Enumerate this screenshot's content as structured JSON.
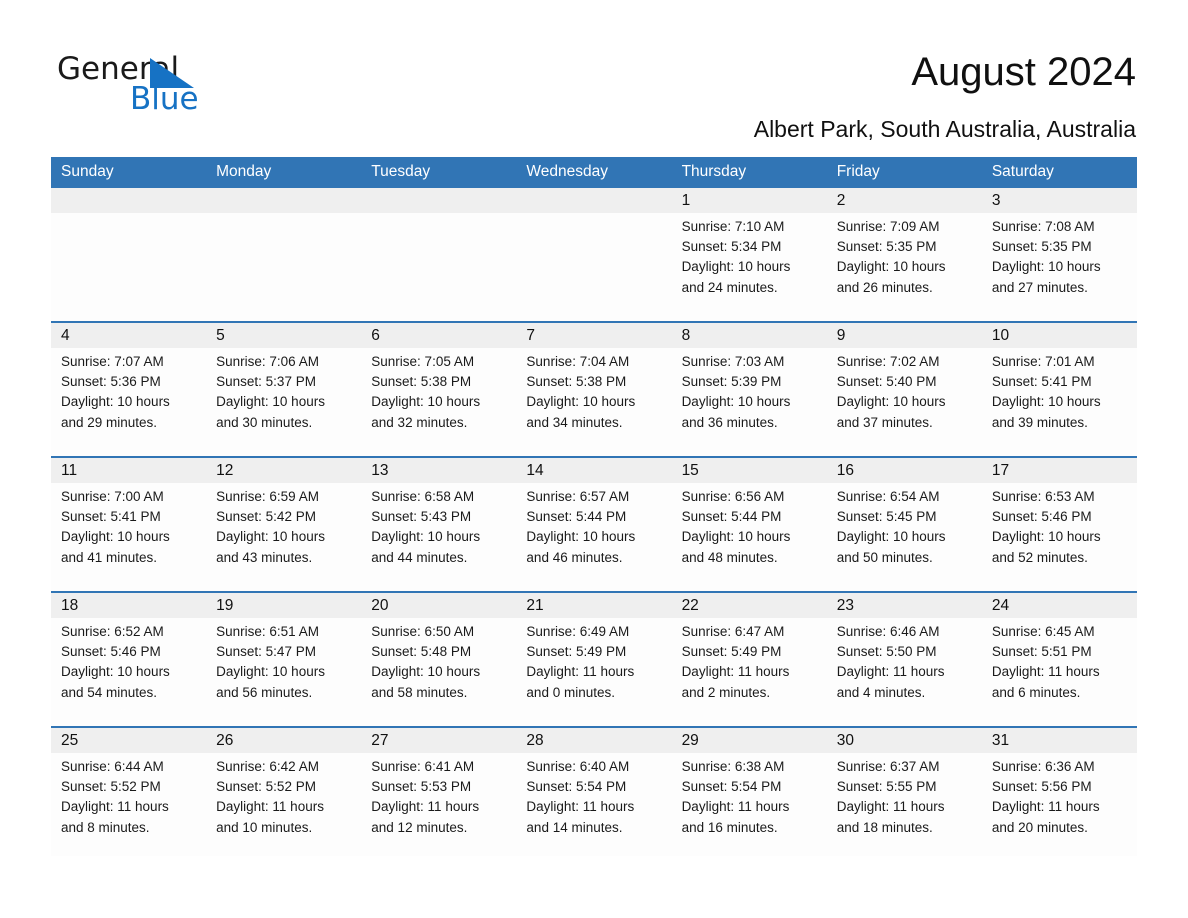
{
  "brand": {
    "name_part1": "General",
    "name_part2": "Blue",
    "accent_color": "#1672c4",
    "header_color": "#3175b5"
  },
  "header": {
    "title": "August 2024",
    "subtitle": "Albert Park, South Australia, Australia"
  },
  "weekdays": [
    "Sunday",
    "Monday",
    "Tuesday",
    "Wednesday",
    "Thursday",
    "Friday",
    "Saturday"
  ],
  "weeks": [
    [
      {
        "day": "",
        "sunrise": "",
        "sunset": "",
        "daylight_line1": "",
        "daylight_line2": ""
      },
      {
        "day": "",
        "sunrise": "",
        "sunset": "",
        "daylight_line1": "",
        "daylight_line2": ""
      },
      {
        "day": "",
        "sunrise": "",
        "sunset": "",
        "daylight_line1": "",
        "daylight_line2": ""
      },
      {
        "day": "",
        "sunrise": "",
        "sunset": "",
        "daylight_line1": "",
        "daylight_line2": ""
      },
      {
        "day": "1",
        "sunrise": "Sunrise: 7:10 AM",
        "sunset": "Sunset: 5:34 PM",
        "daylight_line1": "Daylight: 10 hours",
        "daylight_line2": "and 24 minutes."
      },
      {
        "day": "2",
        "sunrise": "Sunrise: 7:09 AM",
        "sunset": "Sunset: 5:35 PM",
        "daylight_line1": "Daylight: 10 hours",
        "daylight_line2": "and 26 minutes."
      },
      {
        "day": "3",
        "sunrise": "Sunrise: 7:08 AM",
        "sunset": "Sunset: 5:35 PM",
        "daylight_line1": "Daylight: 10 hours",
        "daylight_line2": "and 27 minutes."
      }
    ],
    [
      {
        "day": "4",
        "sunrise": "Sunrise: 7:07 AM",
        "sunset": "Sunset: 5:36 PM",
        "daylight_line1": "Daylight: 10 hours",
        "daylight_line2": "and 29 minutes."
      },
      {
        "day": "5",
        "sunrise": "Sunrise: 7:06 AM",
        "sunset": "Sunset: 5:37 PM",
        "daylight_line1": "Daylight: 10 hours",
        "daylight_line2": "and 30 minutes."
      },
      {
        "day": "6",
        "sunrise": "Sunrise: 7:05 AM",
        "sunset": "Sunset: 5:38 PM",
        "daylight_line1": "Daylight: 10 hours",
        "daylight_line2": "and 32 minutes."
      },
      {
        "day": "7",
        "sunrise": "Sunrise: 7:04 AM",
        "sunset": "Sunset: 5:38 PM",
        "daylight_line1": "Daylight: 10 hours",
        "daylight_line2": "and 34 minutes."
      },
      {
        "day": "8",
        "sunrise": "Sunrise: 7:03 AM",
        "sunset": "Sunset: 5:39 PM",
        "daylight_line1": "Daylight: 10 hours",
        "daylight_line2": "and 36 minutes."
      },
      {
        "day": "9",
        "sunrise": "Sunrise: 7:02 AM",
        "sunset": "Sunset: 5:40 PM",
        "daylight_line1": "Daylight: 10 hours",
        "daylight_line2": "and 37 minutes."
      },
      {
        "day": "10",
        "sunrise": "Sunrise: 7:01 AM",
        "sunset": "Sunset: 5:41 PM",
        "daylight_line1": "Daylight: 10 hours",
        "daylight_line2": "and 39 minutes."
      }
    ],
    [
      {
        "day": "11",
        "sunrise": "Sunrise: 7:00 AM",
        "sunset": "Sunset: 5:41 PM",
        "daylight_line1": "Daylight: 10 hours",
        "daylight_line2": "and 41 minutes."
      },
      {
        "day": "12",
        "sunrise": "Sunrise: 6:59 AM",
        "sunset": "Sunset: 5:42 PM",
        "daylight_line1": "Daylight: 10 hours",
        "daylight_line2": "and 43 minutes."
      },
      {
        "day": "13",
        "sunrise": "Sunrise: 6:58 AM",
        "sunset": "Sunset: 5:43 PM",
        "daylight_line1": "Daylight: 10 hours",
        "daylight_line2": "and 44 minutes."
      },
      {
        "day": "14",
        "sunrise": "Sunrise: 6:57 AM",
        "sunset": "Sunset: 5:44 PM",
        "daylight_line1": "Daylight: 10 hours",
        "daylight_line2": "and 46 minutes."
      },
      {
        "day": "15",
        "sunrise": "Sunrise: 6:56 AM",
        "sunset": "Sunset: 5:44 PM",
        "daylight_line1": "Daylight: 10 hours",
        "daylight_line2": "and 48 minutes."
      },
      {
        "day": "16",
        "sunrise": "Sunrise: 6:54 AM",
        "sunset": "Sunset: 5:45 PM",
        "daylight_line1": "Daylight: 10 hours",
        "daylight_line2": "and 50 minutes."
      },
      {
        "day": "17",
        "sunrise": "Sunrise: 6:53 AM",
        "sunset": "Sunset: 5:46 PM",
        "daylight_line1": "Daylight: 10 hours",
        "daylight_line2": "and 52 minutes."
      }
    ],
    [
      {
        "day": "18",
        "sunrise": "Sunrise: 6:52 AM",
        "sunset": "Sunset: 5:46 PM",
        "daylight_line1": "Daylight: 10 hours",
        "daylight_line2": "and 54 minutes."
      },
      {
        "day": "19",
        "sunrise": "Sunrise: 6:51 AM",
        "sunset": "Sunset: 5:47 PM",
        "daylight_line1": "Daylight: 10 hours",
        "daylight_line2": "and 56 minutes."
      },
      {
        "day": "20",
        "sunrise": "Sunrise: 6:50 AM",
        "sunset": "Sunset: 5:48 PM",
        "daylight_line1": "Daylight: 10 hours",
        "daylight_line2": "and 58 minutes."
      },
      {
        "day": "21",
        "sunrise": "Sunrise: 6:49 AM",
        "sunset": "Sunset: 5:49 PM",
        "daylight_line1": "Daylight: 11 hours",
        "daylight_line2": "and 0 minutes."
      },
      {
        "day": "22",
        "sunrise": "Sunrise: 6:47 AM",
        "sunset": "Sunset: 5:49 PM",
        "daylight_line1": "Daylight: 11 hours",
        "daylight_line2": "and 2 minutes."
      },
      {
        "day": "23",
        "sunrise": "Sunrise: 6:46 AM",
        "sunset": "Sunset: 5:50 PM",
        "daylight_line1": "Daylight: 11 hours",
        "daylight_line2": "and 4 minutes."
      },
      {
        "day": "24",
        "sunrise": "Sunrise: 6:45 AM",
        "sunset": "Sunset: 5:51 PM",
        "daylight_line1": "Daylight: 11 hours",
        "daylight_line2": "and 6 minutes."
      }
    ],
    [
      {
        "day": "25",
        "sunrise": "Sunrise: 6:44 AM",
        "sunset": "Sunset: 5:52 PM",
        "daylight_line1": "Daylight: 11 hours",
        "daylight_line2": "and 8 minutes."
      },
      {
        "day": "26",
        "sunrise": "Sunrise: 6:42 AM",
        "sunset": "Sunset: 5:52 PM",
        "daylight_line1": "Daylight: 11 hours",
        "daylight_line2": "and 10 minutes."
      },
      {
        "day": "27",
        "sunrise": "Sunrise: 6:41 AM",
        "sunset": "Sunset: 5:53 PM",
        "daylight_line1": "Daylight: 11 hours",
        "daylight_line2": "and 12 minutes."
      },
      {
        "day": "28",
        "sunrise": "Sunrise: 6:40 AM",
        "sunset": "Sunset: 5:54 PM",
        "daylight_line1": "Daylight: 11 hours",
        "daylight_line2": "and 14 minutes."
      },
      {
        "day": "29",
        "sunrise": "Sunrise: 6:38 AM",
        "sunset": "Sunset: 5:54 PM",
        "daylight_line1": "Daylight: 11 hours",
        "daylight_line2": "and 16 minutes."
      },
      {
        "day": "30",
        "sunrise": "Sunrise: 6:37 AM",
        "sunset": "Sunset: 5:55 PM",
        "daylight_line1": "Daylight: 11 hours",
        "daylight_line2": "and 18 minutes."
      },
      {
        "day": "31",
        "sunrise": "Sunrise: 6:36 AM",
        "sunset": "Sunset: 5:56 PM",
        "daylight_line1": "Daylight: 11 hours",
        "daylight_line2": "and 20 minutes."
      }
    ]
  ]
}
